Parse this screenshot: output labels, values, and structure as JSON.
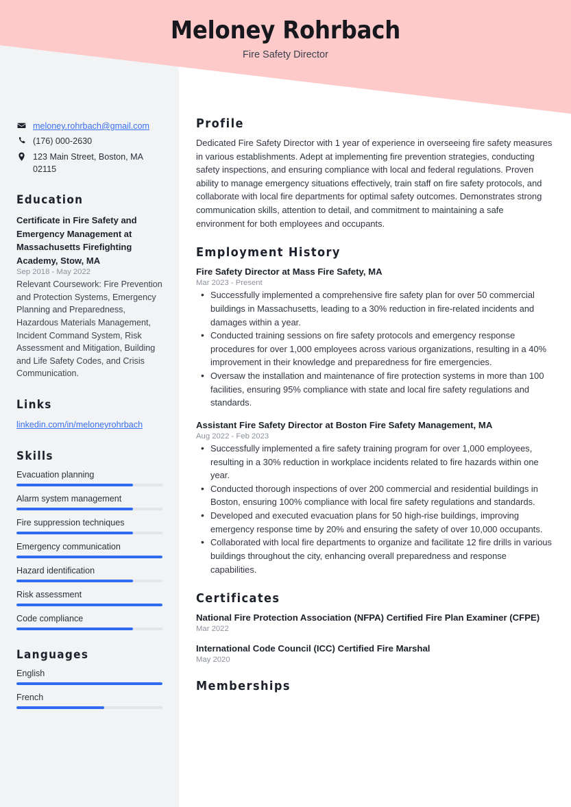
{
  "colors": {
    "header_pink": "#fdc9c9",
    "sidebar_gray": "#f2f3f5",
    "accent_blue": "#2f6bf0",
    "link_blue": "#3a6ff0",
    "text_dark": "#1d212b",
    "text_muted": "#8d919c"
  },
  "header": {
    "name": "Meloney Rohrbach",
    "job_title": "Fire Safety Director"
  },
  "sidebar": {
    "contact": [
      {
        "icon": "envelope-icon",
        "type": "email",
        "value": "meloney.rohrbach@gmail.com"
      },
      {
        "icon": "phone-icon",
        "type": "phone",
        "value": "(176) 000-2630"
      },
      {
        "icon": "location-pin-icon",
        "type": "address",
        "value": "123 Main Street, Boston, MA 02115"
      }
    ],
    "education": {
      "heading": "Education",
      "entries": [
        {
          "title": "Certificate in Fire Safety and Emergency Management at Massachusetts Firefighting Academy, Stow, MA",
          "date": "Sep 2018 - May 2022",
          "description": "Relevant Coursework: Fire Prevention and Protection Systems, Emergency Planning and Preparedness, Hazardous Materials Management, Incident Command System, Risk Assessment and Mitigation, Building and Life Safety Codes, and Crisis Communication."
        }
      ]
    },
    "links": {
      "heading": "Links",
      "items": [
        {
          "label": "linkedin.com/in/meloneyrohrbach"
        }
      ]
    },
    "skills": {
      "heading": "Skills",
      "items": [
        {
          "label": "Evacuation planning",
          "level": 80
        },
        {
          "label": "Alarm system management",
          "level": 80
        },
        {
          "label": "Fire suppression techniques",
          "level": 80
        },
        {
          "label": "Emergency communication",
          "level": 100
        },
        {
          "label": "Hazard identification",
          "level": 80
        },
        {
          "label": "Risk assessment",
          "level": 100
        },
        {
          "label": "Code compliance",
          "level": 80
        }
      ]
    },
    "languages": {
      "heading": "Languages",
      "items": [
        {
          "label": "English",
          "level": 100
        },
        {
          "label": "French",
          "level": 60
        }
      ]
    }
  },
  "main": {
    "profile": {
      "heading": "Profile",
      "text": "Dedicated Fire Safety Director with 1 year of experience in overseeing fire safety measures in various establishments. Adept at implementing fire prevention strategies, conducting safety inspections, and ensuring compliance with local and federal regulations. Proven ability to manage emergency situations effectively, train staff on fire safety protocols, and collaborate with local fire departments for optimal safety outcomes. Demonstrates strong communication skills, attention to detail, and commitment to maintaining a safe environment for both employees and occupants."
    },
    "employment": {
      "heading": "Employment History",
      "jobs": [
        {
          "title": "Fire Safety Director at Mass Fire Safety, MA",
          "date": "Mar 2023 - Present",
          "bullets": [
            "Successfully implemented a comprehensive fire safety plan for over 50 commercial buildings in Massachusetts, leading to a 30% reduction in fire-related incidents and damages within a year.",
            "Conducted training sessions on fire safety protocols and emergency response procedures for over 1,000 employees across various organizations, resulting in a 40% improvement in their knowledge and preparedness for fire emergencies.",
            "Oversaw the installation and maintenance of fire protection systems in more than 100 facilities, ensuring 95% compliance with state and local fire safety regulations and standards."
          ]
        },
        {
          "title": "Assistant Fire Safety Director at Boston Fire Safety Management, MA",
          "date": "Aug 2022 - Feb 2023",
          "bullets": [
            "Successfully implemented a fire safety training program for over 1,000 employees, resulting in a 30% reduction in workplace incidents related to fire hazards within one year.",
            "Conducted thorough inspections of over 200 commercial and residential buildings in Boston, ensuring 100% compliance with local fire safety regulations and standards.",
            "Developed and executed evacuation plans for 50 high-rise buildings, improving emergency response time by 20% and ensuring the safety of over 10,000 occupants.",
            "Collaborated with local fire departments to organize and facilitate 12 fire drills in various buildings throughout the city, enhancing overall preparedness and response capabilities."
          ]
        }
      ]
    },
    "certificates": {
      "heading": "Certificates",
      "items": [
        {
          "title": "National Fire Protection Association (NFPA) Certified Fire Plan Examiner (CFPE)",
          "date": "Mar 2022"
        },
        {
          "title": "International Code Council (ICC) Certified Fire Marshal",
          "date": "May 2020"
        }
      ]
    },
    "memberships": {
      "heading": "Memberships"
    }
  }
}
